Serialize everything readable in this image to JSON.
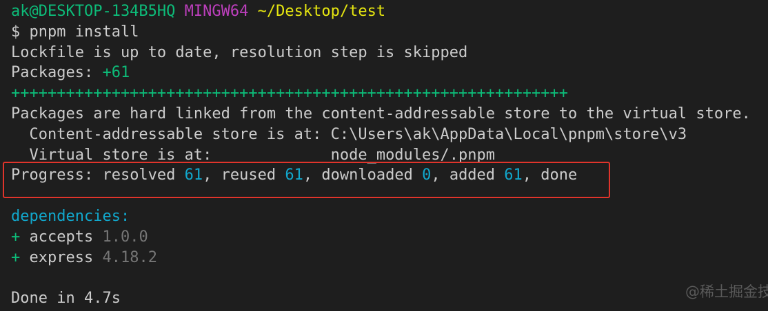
{
  "prompt": {
    "user_host": "ak@DESKTOP-134B5HQ",
    "shell": "MINGW64",
    "path": "~/Desktop/test",
    "symbol": "$",
    "command": "pnpm install"
  },
  "output": {
    "lockfile_msg": "Lockfile is up to date, resolution step is skipped",
    "packages_label": "Packages: ",
    "packages_count": "+61",
    "progress_bar": "+++++++++++++++++++++++++++++++++++++++++++++++++++++++++++++",
    "hardlink_msg": "Packages are hard linked from the content-addressable store to the virtual store.",
    "cas_label": "  Content-addressable store is at: ",
    "cas_path": "C:\\Users\\ak\\AppData\\Local\\pnpm\\store\\v3",
    "virtual_label": "  Virtual store is at:             ",
    "virtual_path": "node_modules/.pnpm",
    "progress": {
      "label": "Progress: ",
      "resolved_label": "resolved ",
      "resolved": "61",
      "reused_label": ", reused ",
      "reused": "61",
      "downloaded_label": ", downloaded ",
      "downloaded": "0",
      "added_label": ", added ",
      "added": "61",
      "done_label": ", done"
    },
    "dependencies_heading": "dependencies:",
    "dependencies": [
      {
        "marker": "+ ",
        "name": "accepts",
        "version": "1.0.0"
      },
      {
        "marker": "+ ",
        "name": "express",
        "version": "4.18.2"
      }
    ],
    "done_msg": "Done in 4.7s"
  },
  "watermark": "@稀土掘金技",
  "colors": {
    "background": "#1e1e1e",
    "highlight_box": "#e0342b"
  }
}
